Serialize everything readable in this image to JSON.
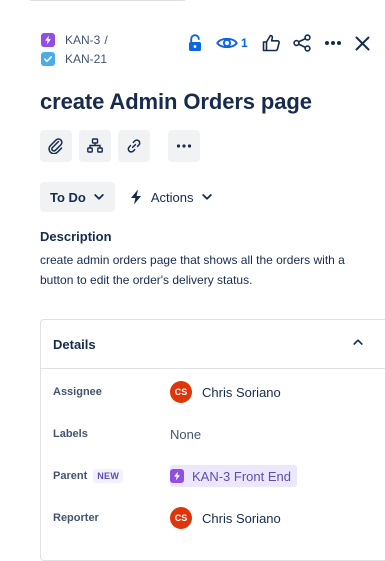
{
  "breadcrumb": {
    "parent_key": "KAN-3",
    "separator": "/",
    "issue_key": "KAN-21"
  },
  "header": {
    "watch_count": "1"
  },
  "issue": {
    "title": "create Admin Orders page",
    "status": "To Do",
    "actions_label": "Actions"
  },
  "description": {
    "label": "Description",
    "text": "create admin orders page that shows all the orders with a button to edit the order's delivery status."
  },
  "details": {
    "title": "Details",
    "assignee": {
      "label": "Assignee",
      "initials": "CS",
      "name": "Chris Soriano"
    },
    "labels": {
      "label": "Labels",
      "value": "None"
    },
    "parent": {
      "label": "Parent",
      "badge": "NEW",
      "value": "KAN-3 Front End"
    },
    "reporter": {
      "label": "Reporter",
      "initials": "CS",
      "name": "Chris Soriano"
    }
  },
  "colors": {
    "epic": "#904ee2",
    "task": "#4bade8",
    "link_blue": "#0c66e4",
    "avatar": "#de350b"
  },
  "icons": [
    "lightning-icon",
    "check-icon",
    "unlock-icon",
    "eye-icon",
    "thumbs-up-icon",
    "share-icon",
    "more-icon",
    "close-icon",
    "attachment-icon",
    "hierarchy-icon",
    "link-icon",
    "chevron-down-icon",
    "chevron-up-icon"
  ]
}
